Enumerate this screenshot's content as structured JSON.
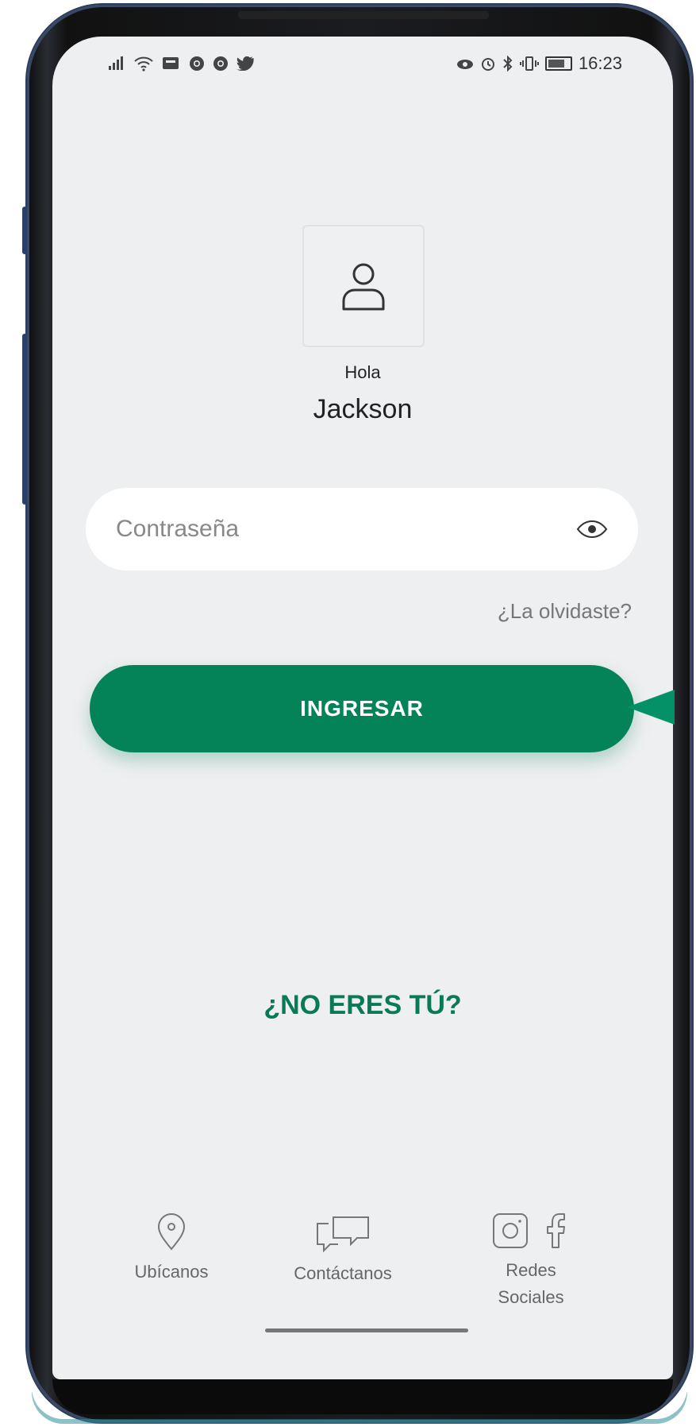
{
  "status_bar": {
    "time": "16:23",
    "left_icons": [
      "signal-icon",
      "wifi-icon",
      "notification-icon",
      "chrome-icon",
      "chrome-icon",
      "twitter-icon"
    ],
    "right_icons": [
      "eye-comfort-icon",
      "alarm-icon",
      "bluetooth-icon",
      "vibrate-icon",
      "battery-icon"
    ]
  },
  "greeting": {
    "hello": "Hola",
    "name": "Jackson"
  },
  "password": {
    "placeholder": "Contraseña",
    "value": ""
  },
  "forgot_label": "¿La olvidaste?",
  "login_button": "INGRESAR",
  "not_you_label": "¿NO ERES TÚ?",
  "bottom_nav": {
    "locate": "Ubícanos",
    "contact": "Contáctanos",
    "social_line1": "Redes",
    "social_line2": "Sociales"
  },
  "colors": {
    "primary": "#058358",
    "background": "#eeeff0",
    "text": "#222222"
  }
}
